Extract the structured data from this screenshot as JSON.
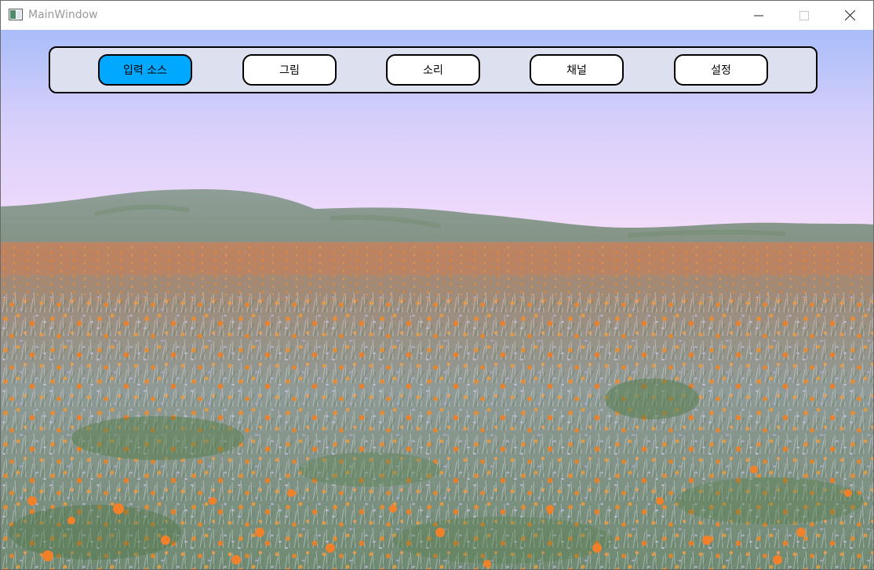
{
  "window": {
    "title": "MainWindow"
  },
  "toolbar": {
    "buttons": [
      {
        "label": "입력 소스",
        "active": true
      },
      {
        "label": "그림",
        "active": false
      },
      {
        "label": "소리",
        "active": false
      },
      {
        "label": "채널",
        "active": false
      },
      {
        "label": "설정",
        "active": false
      }
    ]
  },
  "colors": {
    "active_button": "#00a8ff",
    "toolbar_bg": "#dde0ee",
    "sky_top": "#a9bdf9",
    "sky_bottom": "#f1dcfb"
  },
  "background": {
    "icon": "poppy-field-landscape-image"
  }
}
